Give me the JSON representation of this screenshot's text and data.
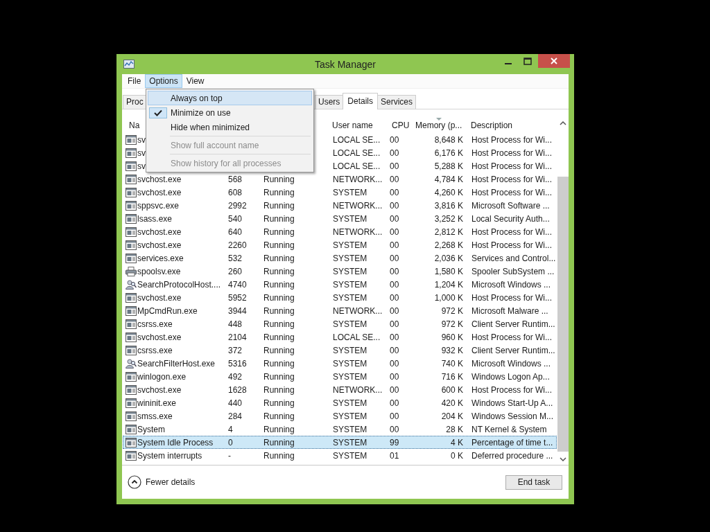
{
  "window": {
    "title": "Task Manager"
  },
  "menubar": [
    {
      "label": "File",
      "selected": false
    },
    {
      "label": "Options",
      "selected": true
    },
    {
      "label": "View",
      "selected": false
    }
  ],
  "tabs": [
    {
      "label": "Proc",
      "selected": false,
      "kind": "left"
    },
    {
      "label": "Users",
      "selected": false,
      "kind": "right"
    },
    {
      "label": "Details",
      "selected": true,
      "kind": "right"
    },
    {
      "label": "Services",
      "selected": false,
      "kind": "right"
    }
  ],
  "table": {
    "columns": [
      {
        "label": "Na"
      },
      {
        "label": "User name"
      },
      {
        "label": "CPU"
      },
      {
        "label": "Memory (p..."
      },
      {
        "label": "Description"
      }
    ],
    "rows": [
      {
        "kind": "app",
        "name": "sv",
        "user": "LOCAL SE...",
        "cpu": "00",
        "memory": "8,648 K",
        "description": "Host Process for Wi...",
        "selected": false
      },
      {
        "kind": "app",
        "name": "sv",
        "user": "LOCAL SE...",
        "cpu": "00",
        "memory": "6,176 K",
        "description": "Host Process for Wi...",
        "selected": false
      },
      {
        "kind": "app",
        "name": "sv",
        "user": "LOCAL SE...",
        "cpu": "00",
        "memory": "5,288 K",
        "description": "Host Process for Wi...",
        "selected": false
      },
      {
        "kind": "app",
        "name": "svchost.exe",
        "pid": "568",
        "status": "Running",
        "user": "NETWORK...",
        "cpu": "00",
        "memory": "4,784 K",
        "description": "Host Process for Wi...",
        "selected": false
      },
      {
        "kind": "app",
        "name": "svchost.exe",
        "pid": "608",
        "status": "Running",
        "user": "SYSTEM",
        "cpu": "00",
        "memory": "4,260 K",
        "description": "Host Process for Wi...",
        "selected": false
      },
      {
        "kind": "app",
        "name": "sppsvc.exe",
        "pid": "2992",
        "status": "Running",
        "user": "NETWORK...",
        "cpu": "00",
        "memory": "3,816 K",
        "description": "Microsoft Software ...",
        "selected": false
      },
      {
        "kind": "app",
        "name": "lsass.exe",
        "pid": "540",
        "status": "Running",
        "user": "SYSTEM",
        "cpu": "00",
        "memory": "3,252 K",
        "description": "Local Security Auth...",
        "selected": false
      },
      {
        "kind": "app",
        "name": "svchost.exe",
        "pid": "640",
        "status": "Running",
        "user": "NETWORK...",
        "cpu": "00",
        "memory": "2,812 K",
        "description": "Host Process for Wi...",
        "selected": false
      },
      {
        "kind": "app",
        "name": "svchost.exe",
        "pid": "2260",
        "status": "Running",
        "user": "SYSTEM",
        "cpu": "00",
        "memory": "2,268 K",
        "description": "Host Process for Wi...",
        "selected": false
      },
      {
        "kind": "app",
        "name": "services.exe",
        "pid": "532",
        "status": "Running",
        "user": "SYSTEM",
        "cpu": "00",
        "memory": "2,036 K",
        "description": "Services and Control...",
        "selected": false
      },
      {
        "kind": "printer",
        "name": "spoolsv.exe",
        "pid": "260",
        "status": "Running",
        "user": "SYSTEM",
        "cpu": "00",
        "memory": "1,580 K",
        "description": "Spooler SubSystem ...",
        "selected": false
      },
      {
        "kind": "search",
        "name": "SearchProtocolHost....",
        "pid": "4740",
        "status": "Running",
        "user": "SYSTEM",
        "cpu": "00",
        "memory": "1,204 K",
        "description": "Microsoft Windows ...",
        "selected": false
      },
      {
        "kind": "app",
        "name": "svchost.exe",
        "pid": "5952",
        "status": "Running",
        "user": "SYSTEM",
        "cpu": "00",
        "memory": "1,000 K",
        "description": "Host Process for Wi...",
        "selected": false
      },
      {
        "kind": "app",
        "name": "MpCmdRun.exe",
        "pid": "3944",
        "status": "Running",
        "user": "NETWORK...",
        "cpu": "00",
        "memory": "972 K",
        "description": "Microsoft Malware ...",
        "selected": false
      },
      {
        "kind": "app",
        "name": "csrss.exe",
        "pid": "448",
        "status": "Running",
        "user": "SYSTEM",
        "cpu": "00",
        "memory": "972 K",
        "description": "Client Server Runtim...",
        "selected": false
      },
      {
        "kind": "app",
        "name": "svchost.exe",
        "pid": "2104",
        "status": "Running",
        "user": "LOCAL SE...",
        "cpu": "00",
        "memory": "960 K",
        "description": "Host Process for Wi...",
        "selected": false
      },
      {
        "kind": "app",
        "name": "csrss.exe",
        "pid": "372",
        "status": "Running",
        "user": "SYSTEM",
        "cpu": "00",
        "memory": "932 K",
        "description": "Client Server Runtim...",
        "selected": false
      },
      {
        "kind": "search",
        "name": "SearchFilterHost.exe",
        "pid": "5316",
        "status": "Running",
        "user": "SYSTEM",
        "cpu": "00",
        "memory": "740 K",
        "description": "Microsoft Windows ...",
        "selected": false
      },
      {
        "kind": "app",
        "name": "winlogon.exe",
        "pid": "492",
        "status": "Running",
        "user": "SYSTEM",
        "cpu": "00",
        "memory": "716 K",
        "description": "Windows Logon Ap...",
        "selected": false
      },
      {
        "kind": "app",
        "name": "svchost.exe",
        "pid": "1628",
        "status": "Running",
        "user": "NETWORK...",
        "cpu": "00",
        "memory": "600 K",
        "description": "Host Process for Wi...",
        "selected": false
      },
      {
        "kind": "app",
        "name": "wininit.exe",
        "pid": "440",
        "status": "Running",
        "user": "SYSTEM",
        "cpu": "00",
        "memory": "420 K",
        "description": "Windows Start-Up A...",
        "selected": false
      },
      {
        "kind": "app",
        "name": "smss.exe",
        "pid": "284",
        "status": "Running",
        "user": "SYSTEM",
        "cpu": "00",
        "memory": "204 K",
        "description": "Windows Session M...",
        "selected": false
      },
      {
        "kind": "app",
        "name": "System",
        "pid": "4",
        "status": "Running",
        "user": "SYSTEM",
        "cpu": "00",
        "memory": "28 K",
        "description": "NT Kernel & System",
        "selected": false
      },
      {
        "kind": "app",
        "name": "System Idle Process",
        "pid": "0",
        "status": "Running",
        "user": "SYSTEM",
        "cpu": "99",
        "memory": "4 K",
        "description": "Percentage of time t...",
        "selected": true
      },
      {
        "kind": "app",
        "name": "System interrupts",
        "pid": "-",
        "status": "Running",
        "user": "SYSTEM",
        "cpu": "01",
        "memory": "0 K",
        "description": "Deferred procedure ...",
        "selected": false
      }
    ]
  },
  "options_menu": [
    {
      "kind": "item",
      "label": "Always on top",
      "checked": false,
      "disabled": false,
      "selected": true
    },
    {
      "kind": "item",
      "label": "Minimize on use",
      "checked": true,
      "disabled": false,
      "selected": false
    },
    {
      "kind": "item",
      "label": "Hide when minimized",
      "checked": false,
      "disabled": false,
      "selected": false
    },
    {
      "kind": "separator"
    },
    {
      "kind": "item",
      "label": "Show full account name",
      "checked": false,
      "disabled": true,
      "selected": false
    },
    {
      "kind": "separator"
    },
    {
      "kind": "item",
      "label": "Show history for all processes",
      "checked": false,
      "disabled": true,
      "selected": false
    }
  ],
  "footer": {
    "toggle": "Fewer details",
    "button": "End task"
  }
}
